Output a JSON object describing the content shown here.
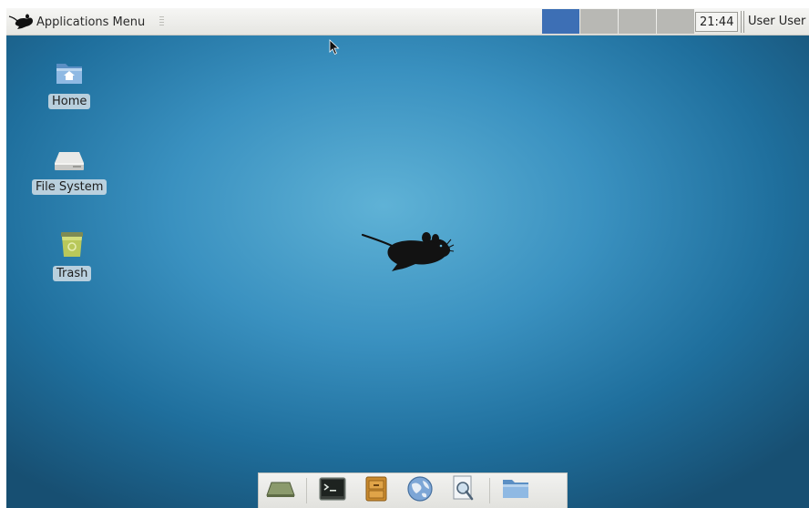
{
  "panel": {
    "app_menu_label": "Applications Menu",
    "clock": "21:44",
    "user_menu": "User User",
    "workspaces": [
      {
        "active": true
      },
      {
        "active": false
      },
      {
        "active": false
      },
      {
        "active": false
      }
    ]
  },
  "desktop": {
    "icons": [
      {
        "label": "Home",
        "icon": "home-folder-icon"
      },
      {
        "label": "File System",
        "icon": "hard-drive-icon"
      },
      {
        "label": "Trash",
        "icon": "trash-icon"
      }
    ]
  },
  "dock": {
    "items": [
      {
        "icon": "show-desktop-icon"
      },
      {
        "icon": "terminal-icon"
      },
      {
        "icon": "file-cabinet-icon"
      },
      {
        "icon": "web-browser-globe-icon"
      },
      {
        "icon": "search-document-icon"
      },
      {
        "icon": "folder-icon"
      }
    ]
  },
  "colors": {
    "desktop_center": "#5fb2d6",
    "desktop_edge": "#174f72",
    "workspace_active": "#3d6fb5",
    "workspace_inactive": "#b8b8b4"
  }
}
